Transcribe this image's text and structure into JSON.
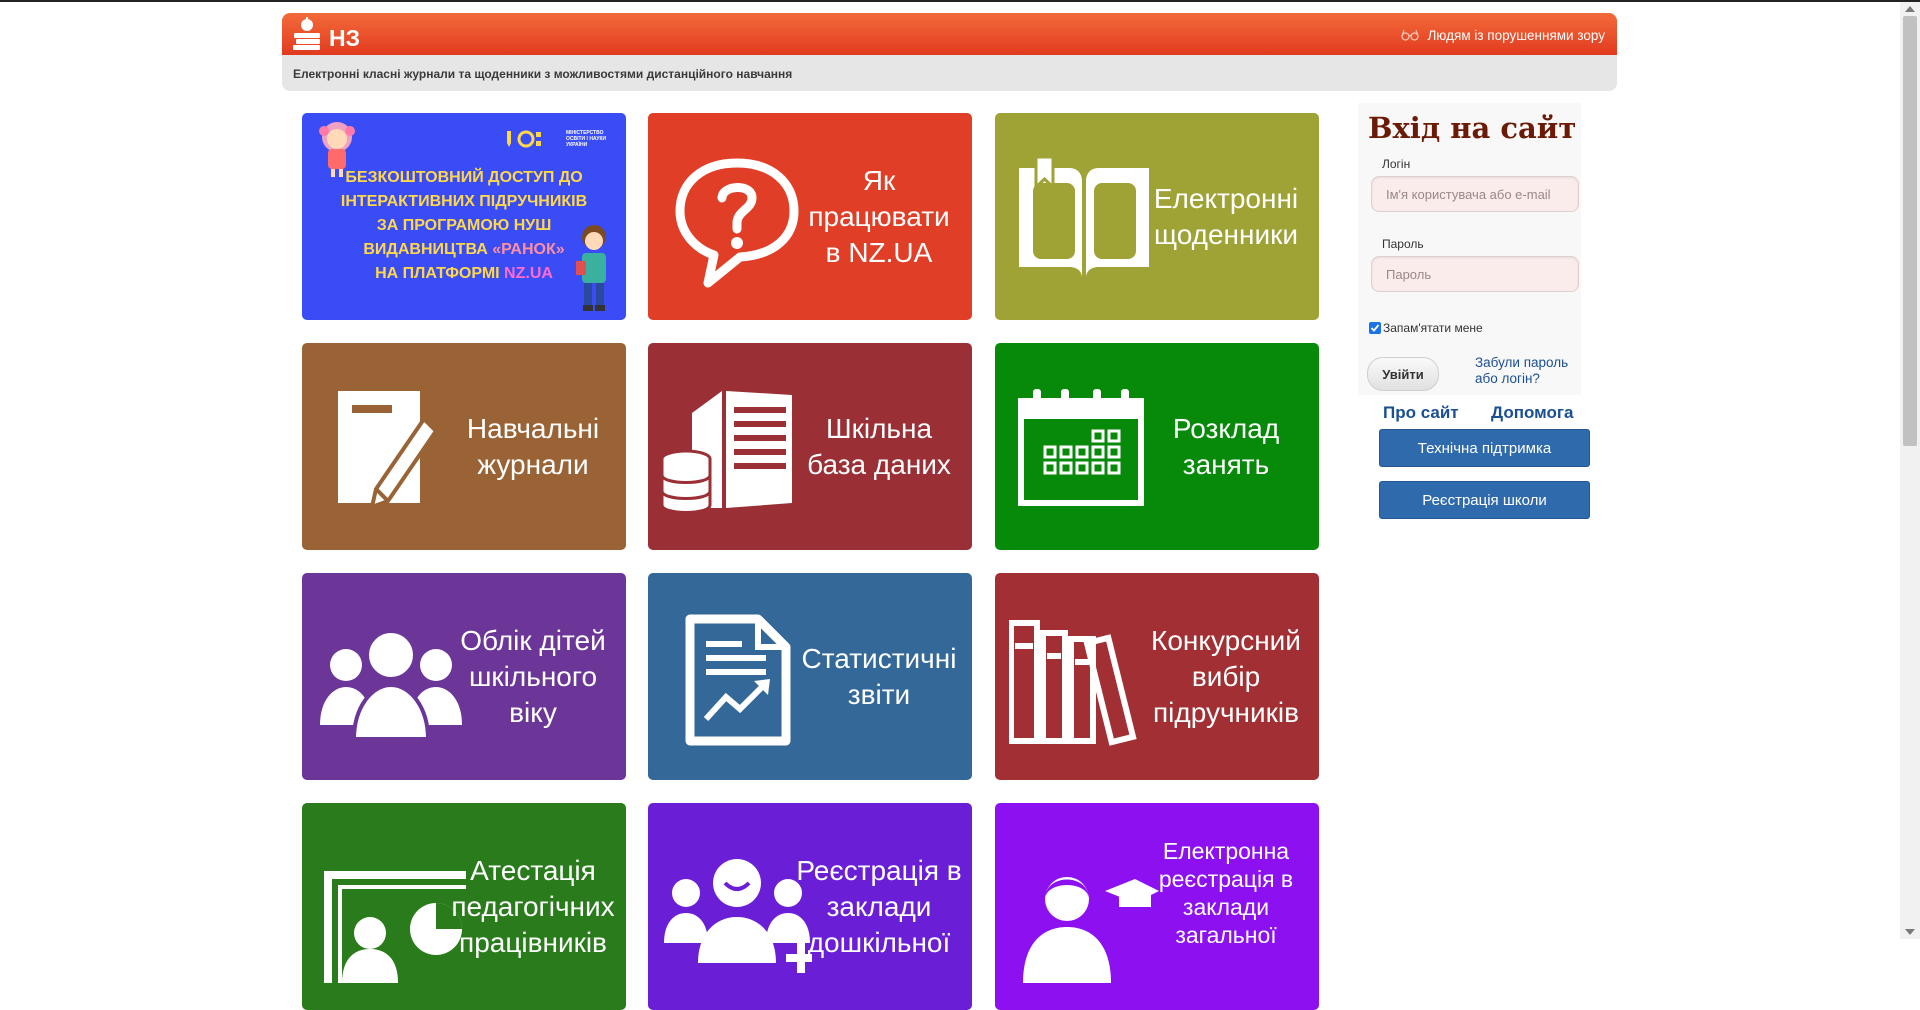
{
  "header": {
    "logo_text": "НЗ",
    "vision_link": "Людям із порушеннями зору",
    "subtitle": "Електронні класні журнали та щоденники з можливостями дистанційного навчання"
  },
  "promo": {
    "ministry": "МІНІСТЕРСТВО ОСВІТИ І НАУКИ УКРАЇНИ",
    "line1": "БЕЗКОШТОВНИЙ ДОСТУП ДО",
    "line2": "ІНТЕРАКТИВНИХ ПІДРУЧНИКІВ",
    "line3": "ЗА ПРОГРАМОЮ НУШ",
    "line4_a": "ВИДАВНИЦТВА ",
    "line4_b": "«РАНОК»",
    "line5_a": "НА ПЛАТФОРМІ ",
    "line5_b": "NZ.UA"
  },
  "tiles": [
    {
      "lines": [
        "Як",
        "працювати",
        "в NZ.UA"
      ],
      "color": "#e03e26",
      "icon": "question-bubble-icon"
    },
    {
      "lines": [
        "Електронні",
        "щоденники"
      ],
      "color": "#9fa234",
      "icon": "open-book-icon"
    },
    {
      "lines": [
        "Навчальні",
        "журнали"
      ],
      "color": "#996336",
      "icon": "journal-pencil-icon"
    },
    {
      "lines": [
        "Шкільна",
        "база даних"
      ],
      "color": "#9a2f36",
      "icon": "database-building-icon"
    },
    {
      "lines": [
        "Розклад",
        "занять"
      ],
      "color": "#078a0a",
      "icon": "calendar-icon"
    },
    {
      "lines": [
        "Облік дітей",
        "шкільного",
        "віку"
      ],
      "color": "#6b3698",
      "icon": "people-group-icon"
    },
    {
      "lines": [
        "Статистичні",
        "звіти"
      ],
      "color": "#336899",
      "icon": "report-chart-icon"
    },
    {
      "lines": [
        "Конкурсний",
        "вибір",
        "підручників"
      ],
      "color": "#a22f33",
      "icon": "books-icon"
    },
    {
      "lines": [
        "Атестація",
        "педагогічних",
        "працівників"
      ],
      "color": "#2a7b1b",
      "icon": "teacher-board-icon"
    },
    {
      "lines": [
        "Реєстрація в",
        "заклади",
        "дошкільної"
      ],
      "color": "#6a1fd6",
      "icon": "kids-group-icon"
    },
    {
      "lines": [
        "Електронна",
        "реєстрація в",
        "заклади",
        "загальної"
      ],
      "color": "#8d10f0",
      "icon": "graduate-icon"
    }
  ],
  "login": {
    "title": "Вхід на сайт",
    "login_label": "Логін",
    "login_placeholder": "Ім'я користувача або e-mail",
    "password_label": "Пароль",
    "password_placeholder": "Пароль",
    "remember_label": "Запам'ятати мене",
    "remember_checked": true,
    "submit_label": "Увійти",
    "forgot_label": "Забули пароль або логін?"
  },
  "links": {
    "about": "Про сайт",
    "help": "Допомога"
  },
  "buttons": {
    "support": "Технічна підтримка",
    "register_school": "Реєстрація школи"
  }
}
